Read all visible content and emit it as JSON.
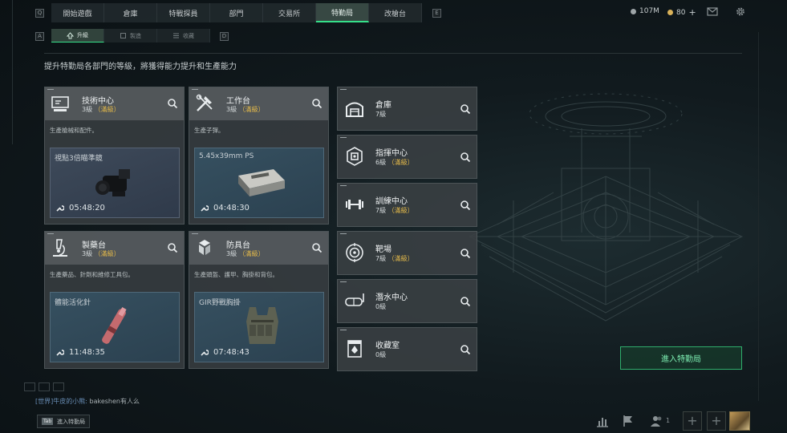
{
  "nav": {
    "key_left": "Q",
    "key_right": "E",
    "tabs": [
      {
        "label": "開始遊戲",
        "active": false
      },
      {
        "label": "倉庫",
        "active": false
      },
      {
        "label": "特戰探員",
        "active": false
      },
      {
        "label": "部門",
        "active": false
      },
      {
        "label": "交易所",
        "active": false
      },
      {
        "label": "特勤局",
        "active": true
      },
      {
        "label": "改槍台",
        "active": false
      }
    ],
    "currency_1": "107M",
    "currency_2": "80",
    "plus": "+",
    "colors": {
      "accent": "#36e08a",
      "maxed": "#e3b94a"
    }
  },
  "subnav": {
    "key_left": "A",
    "key_right": "D",
    "tabs": [
      {
        "label": "升級",
        "icon": "upgrade-icon",
        "active": true
      },
      {
        "label": "製造",
        "icon": "craft-icon",
        "active": false
      },
      {
        "label": "收藏",
        "icon": "collection-icon",
        "active": false
      }
    ]
  },
  "description": "提升特勤局各部門的等級，將獲得能力提升和生產能力",
  "production_cards": [
    {
      "name": "技術中心",
      "level": "3級",
      "maxed": "（滿級）",
      "desc": "生產槍械和配件。",
      "product": "視點3倍瞄準鏡",
      "timer": "05:48:20",
      "icon": "monitor-icon"
    },
    {
      "name": "工作台",
      "level": "3級",
      "maxed": "（滿級）",
      "desc": "生產子彈。",
      "product": "5.45x39mm PS",
      "timer": "04:48:30",
      "icon": "tools-icon"
    },
    {
      "name": "製藥台",
      "level": "3級",
      "maxed": "（滿級）",
      "desc": "生產藥品、針劑和維修工具包。",
      "product": "體能活化針",
      "timer": "11:48:35",
      "icon": "microscope-icon"
    },
    {
      "name": "防具台",
      "level": "3級",
      "maxed": "（滿級）",
      "desc": "生產頭盔、護甲、胸掛和背包。",
      "product": "GIR野戰胸掛",
      "timer": "07:48:43",
      "icon": "armor-icon"
    }
  ],
  "departments": [
    {
      "name": "倉庫",
      "level": "7級",
      "maxed": "",
      "icon": "warehouse-icon"
    },
    {
      "name": "指揮中心",
      "level": "6級",
      "maxed": "（滿級）",
      "icon": "command-center-icon"
    },
    {
      "name": "訓練中心",
      "level": "7級",
      "maxed": "（滿級）",
      "icon": "dumbbell-icon"
    },
    {
      "name": "靶場",
      "level": "7級",
      "maxed": "（滿級）",
      "icon": "target-icon"
    },
    {
      "name": "潛水中心",
      "level": "0級",
      "maxed": "",
      "icon": "diving-mask-icon"
    },
    {
      "name": "收藏室",
      "level": "0級",
      "maxed": "",
      "icon": "collection-room-icon"
    }
  ],
  "enter_button": "進入特勤局",
  "chat": {
    "channel": "[世界]",
    "sender": "牛皮的小熊:",
    "message": "bakeshen有人么 "
  },
  "footer": {
    "tab_key": "Tab",
    "tab_label": "進入特勤局",
    "team_count": "1"
  }
}
